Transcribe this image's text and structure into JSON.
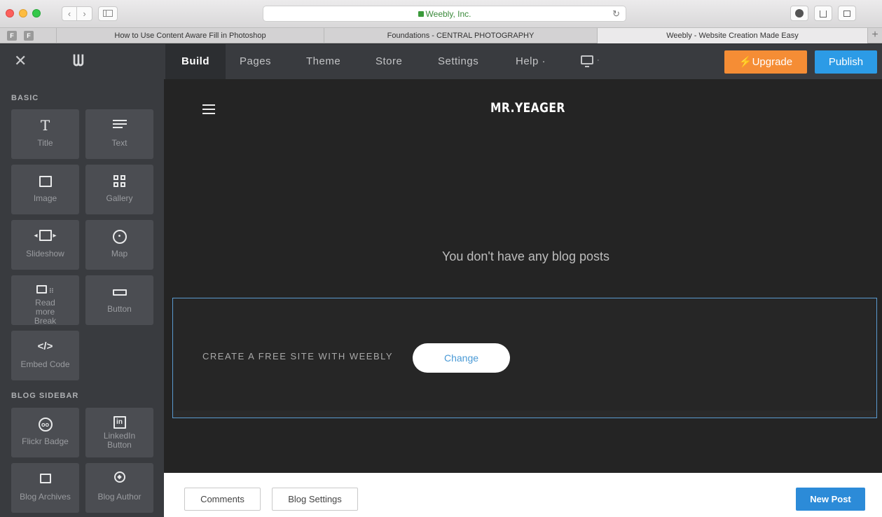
{
  "browser": {
    "url_title": "Weebly, Inc.",
    "pinned_tabs": [
      "F",
      "F"
    ],
    "tabs": [
      {
        "title": "How to Use Content Aware Fill in Photoshop",
        "active": false
      },
      {
        "title": "Foundations - CENTRAL PHOTOGRAPHY",
        "active": false
      },
      {
        "title": "Weebly - Website Creation Made Easy",
        "active": true
      }
    ],
    "new_tab_label": "+",
    "back_glyph": "‹",
    "forward_glyph": "›",
    "reload_glyph": "↻"
  },
  "topnav": {
    "close_glyph": "✕",
    "logo": "ᗯ",
    "items": [
      {
        "label": "Build",
        "active": true
      },
      {
        "label": "Pages",
        "active": false
      },
      {
        "label": "Theme",
        "active": false
      },
      {
        "label": "Store",
        "active": false
      },
      {
        "label": "Settings",
        "active": false
      },
      {
        "label": "Help ·",
        "active": false
      }
    ],
    "device_caret": "·",
    "upgrade_label": "⚡Upgrade",
    "publish_label": "Publish",
    "colors": {
      "upgrade": "#f58d35",
      "publish": "#2c9be6"
    }
  },
  "panel": {
    "sections": [
      {
        "label": "BASIC",
        "elements": [
          {
            "label": "Title",
            "icon": "title-icon"
          },
          {
            "label": "Text",
            "icon": "text-icon"
          },
          {
            "label": "Image",
            "icon": "image-icon"
          },
          {
            "label": "Gallery",
            "icon": "gallery-icon"
          },
          {
            "label": "Slideshow",
            "icon": "slideshow-icon"
          },
          {
            "label": "Map",
            "icon": "map-pin-icon"
          },
          {
            "label": "Read more Break",
            "icon": "read-more-icon"
          },
          {
            "label": "Button",
            "icon": "button-icon"
          },
          {
            "label": "Embed Code",
            "icon": "embed-code-icon"
          }
        ]
      },
      {
        "label": "BLOG SIDEBAR",
        "elements": [
          {
            "label": "Flickr Badge",
            "icon": "flickr-icon"
          },
          {
            "label": "LinkedIn Button",
            "icon": "linkedin-icon"
          },
          {
            "label": "Blog Archives",
            "icon": "archives-icon"
          },
          {
            "label": "Blog Author",
            "icon": "author-pen-icon"
          }
        ]
      }
    ]
  },
  "canvas": {
    "site_title": "MR.YEAGER",
    "empty_message": "You don't have any blog posts",
    "banner_text": "CREATE A FREE SITE WITH WEEBLY",
    "change_label": "Change"
  },
  "bottombar": {
    "comments_label": "Comments",
    "blog_settings_label": "Blog Settings",
    "new_post_label": "New Post"
  }
}
